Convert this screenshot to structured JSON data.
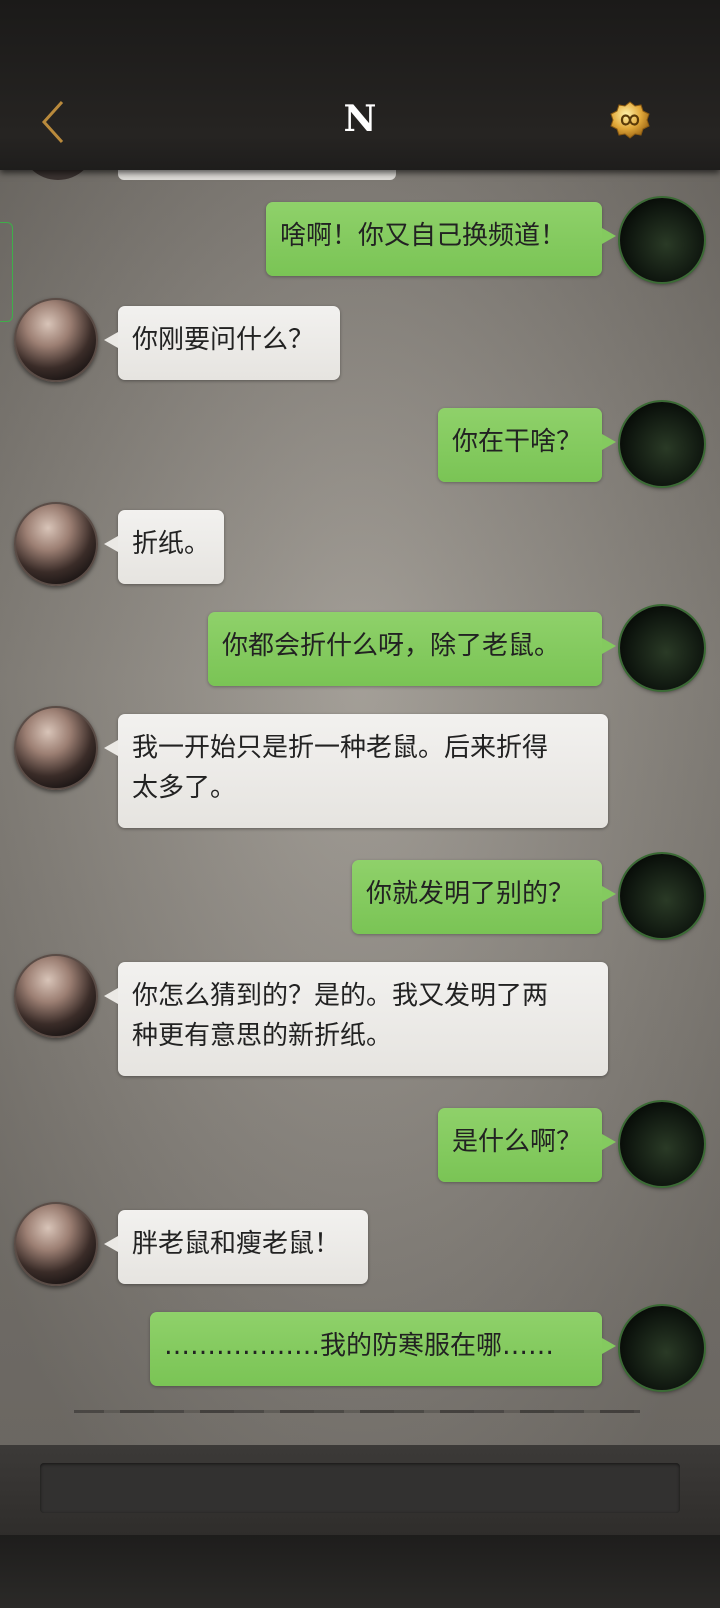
{
  "header": {
    "title": "N",
    "back_icon": "chevron-left-icon",
    "badge_icon": "infinity-badge-icon",
    "accent_color": "#c8a050"
  },
  "messages": [
    {
      "from": "me",
      "text": "啥啊！你又自己换频道！"
    },
    {
      "from": "other",
      "text": "你刚要问什么？"
    },
    {
      "from": "me",
      "text": "你在干啥？"
    },
    {
      "from": "other",
      "text": "折纸。"
    },
    {
      "from": "me",
      "text": "你都会折什么呀，除了老鼠。"
    },
    {
      "from": "other",
      "text": "我一开始只是折一种老鼠。后来折得\n太多了。"
    },
    {
      "from": "me",
      "text": "你就发明了别的？"
    },
    {
      "from": "other",
      "text": "你怎么猜到的？是的。我又发明了两\n种更有意思的新折纸。"
    },
    {
      "from": "me",
      "text": "是什么啊？"
    },
    {
      "from": "other",
      "text": "胖老鼠和瘦老鼠！"
    },
    {
      "from": "me",
      "text": "………………我的防寒服在哪……"
    }
  ],
  "colors": {
    "my_bubble": "#84ca5f",
    "other_bubble": "#ebe9e5"
  }
}
